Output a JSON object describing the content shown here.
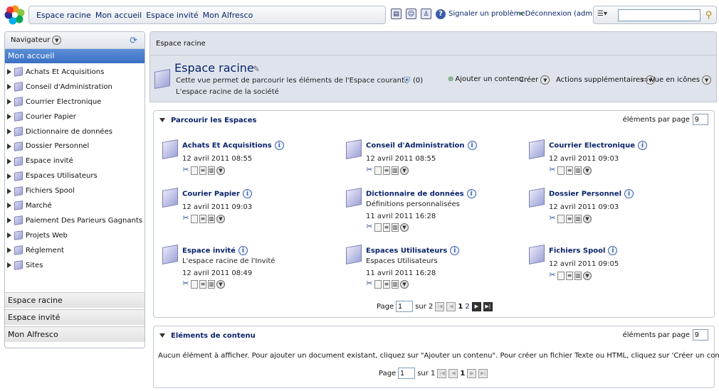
{
  "topbar": {
    "nav_links": [
      "Espace racine",
      "Mon accueil",
      "Espace invité",
      "Mon Alfresco"
    ],
    "report_problem": "Signaler un problème",
    "logout": "Déconnexion (admin)",
    "search_value": ""
  },
  "sidebar": {
    "navigator_label": "Navigateur",
    "selected": "Mon accueil",
    "tree": [
      "Achats Et Acquisitions",
      "Conseil d'Administration",
      "Courrier Electronique",
      "Courier Papier",
      "Dictionnaire de données",
      "Dossier Personnel",
      "Espace invité",
      "Espaces Utilisateurs",
      "Fichiers Spool",
      "Marché",
      "Paiement Des Parieurs Gagnants",
      "Projets Web",
      "Réglement",
      "Sites"
    ],
    "bottom_sections": [
      "Espace racine",
      "Espace invité",
      "Mon Alfresco"
    ]
  },
  "header": {
    "breadcrumb": "Espace racine",
    "title": "Espace racine",
    "desc1": "Cette vue permet de parcourir les éléments de l'Espace courant.",
    "desc2": "L'espace racine de la société",
    "count": "(0)",
    "add_content": "Ajouter un contenu",
    "create": "Créer",
    "more_actions": "Actions supplémentaires",
    "view": "Vue en icônes"
  },
  "spaces_panel": {
    "title": "Parcourir les Espaces",
    "per_page_label": "éléments par page",
    "per_page_value": "9",
    "cards": [
      {
        "title": "Achats Et Acquisitions",
        "desc": "",
        "date": "12 avril 2011 08:55"
      },
      {
        "title": "Conseil d'Administration",
        "desc": "",
        "date": "12 avril 2011 08:55"
      },
      {
        "title": "Courrier Electronique",
        "desc": "",
        "date": "12 avril 2011 09:03"
      },
      {
        "title": "Courier Papier",
        "desc": "",
        "date": "12 avril 2011 09:03"
      },
      {
        "title": "Dictionnaire de données",
        "desc": "Définitions personnalisées",
        "date": "11 avril 2011 16:28"
      },
      {
        "title": "Dossier Personnel",
        "desc": "",
        "date": "12 avril 2011 09:03"
      },
      {
        "title": "Espace invité",
        "desc": "L'espace racine de l'Invité",
        "date": "12 avril 2011 08:49"
      },
      {
        "title": "Espaces Utilisateurs",
        "desc": "Espaces Utilisateurs",
        "date": "11 avril 2011 16:28"
      },
      {
        "title": "Fichiers Spool",
        "desc": "",
        "date": "12 avril 2011 09:05"
      }
    ],
    "pager": {
      "page_label": "Page",
      "page_value": "1",
      "of_label": "sur 2",
      "page1": "1",
      "page2": "2"
    }
  },
  "content_panel": {
    "title": "Eléments de contenu",
    "per_page_label": "éléments par page",
    "per_page_value": "9",
    "empty_message": "Aucun élément à afficher. Pour ajouter un document existant, cliquez sur \"Ajouter un contenu\". Pour créer un fichier Texte ou HTML, cliquez sur 'Créer un contenu'.",
    "pager": {
      "page_label": "Page",
      "page_value": "1",
      "of_label": "sur 1",
      "page1": "1"
    }
  }
}
